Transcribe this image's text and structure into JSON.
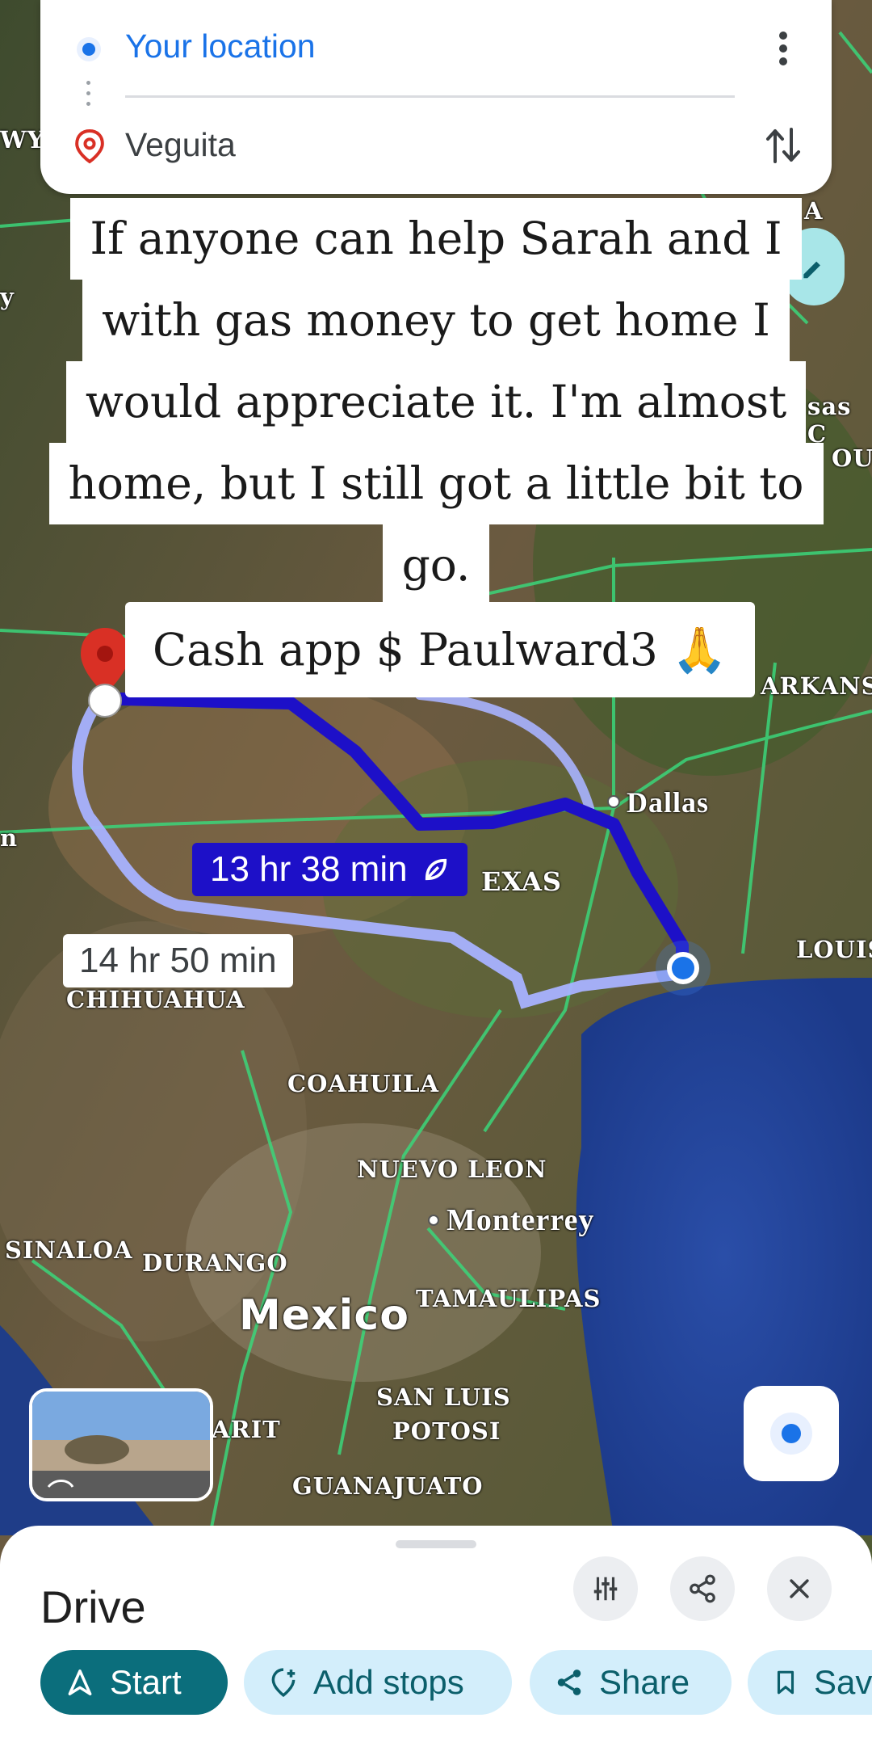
{
  "search": {
    "origin": "Your location",
    "destination": "Veguita"
  },
  "caption": {
    "lines": [
      "If anyone can help Sarah and I",
      "with gas money to get home I",
      "would appreciate it. I'm almost",
      "home, but I still got a little bit to",
      "go."
    ],
    "cash": "Cash app $ Paulward3 🙏"
  },
  "routes": {
    "fastest": "13 hr 38 min",
    "alternate": "14 hr 50 min"
  },
  "map_labels": {
    "dallas": "Dallas",
    "texas": "EXAS",
    "chihuahua": "CHIHUAHUA",
    "coahuila": "COAHUILA",
    "nuevo_leon": "NUEVO LEON",
    "monterrey": "Monterrey",
    "sinaloa": "SINALOA",
    "durango": "DURANGO",
    "mexico": "Mexico",
    "tamaulipas": "TAMAULIPAS",
    "san_luis": "SAN LUIS",
    "potosi": "POTOSI",
    "guanajuato": "GUANAJUATO",
    "arit": "ARIT",
    "arkansas": "ARKANS",
    "louisiana": "LOUIS",
    "kansas": "sas C",
    "ou": "OU",
    "wy": "WY",
    "a": "A",
    "y": "y",
    "n": "n"
  },
  "sheet": {
    "title": "Drive",
    "start": "Start",
    "add_stops": "Add stops",
    "share": "Share",
    "save": "Sav"
  },
  "colors": {
    "accent_blue": "#1a73e8",
    "route_primary": "#1d10c8",
    "route_alt": "#8f9bff",
    "start_button": "#0b6e7c",
    "chip_bg": "#d3eefb",
    "pin_red": "#d93025"
  }
}
